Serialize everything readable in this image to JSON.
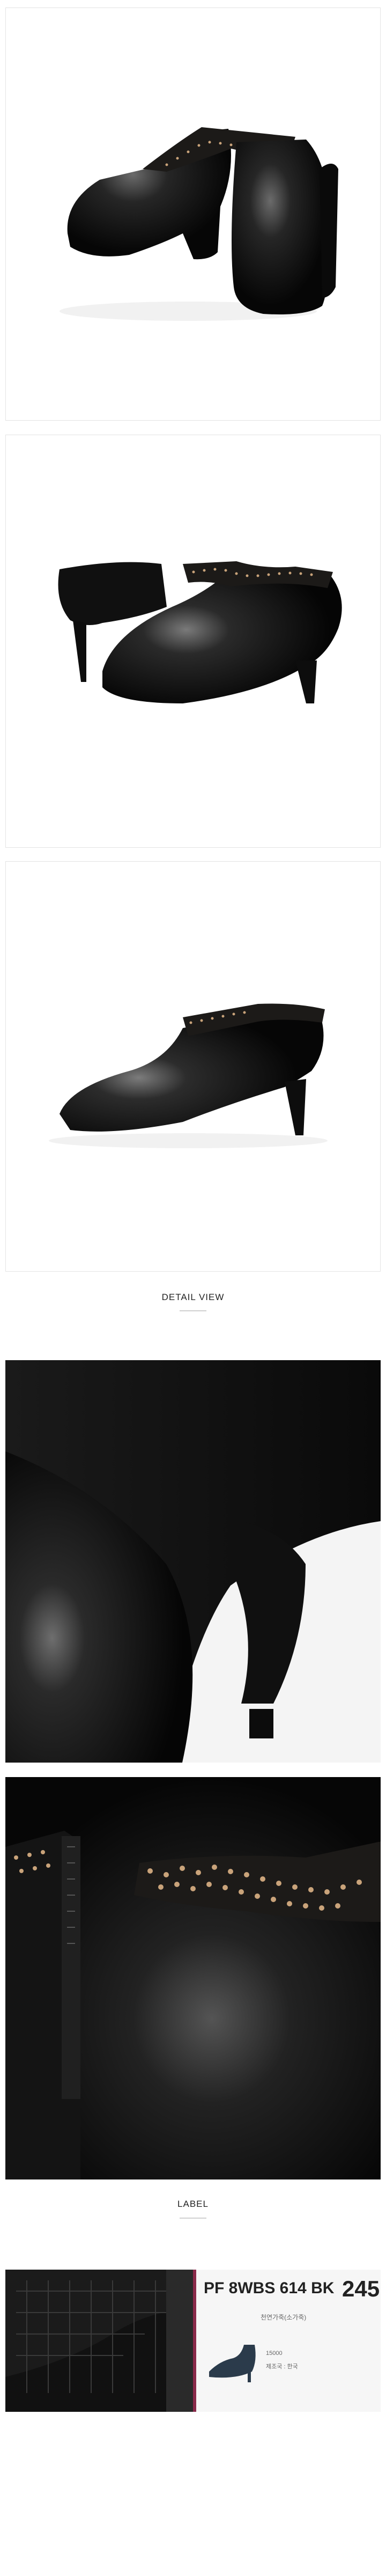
{
  "sections": {
    "detail_view": "DETAIL VIEW",
    "label": "LABEL"
  },
  "label_tag": {
    "product_code": "PF 8WBS 614 BK",
    "size": "245",
    "material_line": "천연가죽(소가죽)",
    "origin_line": "제조국 : 한국",
    "small_code": "15000"
  },
  "colors": {
    "leather": "#0f0f0f",
    "suede_band": "#1c1a18",
    "studs": "#c9a37a",
    "tag_border": "#8a2a4a",
    "background": "#ffffff"
  }
}
